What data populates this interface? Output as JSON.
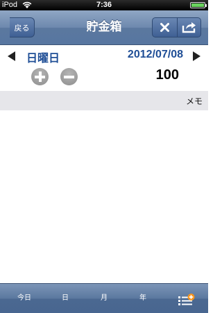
{
  "status_bar": {
    "carrier": "iPod",
    "time": "7:36"
  },
  "nav": {
    "back_label": "戻る",
    "title": "貯金箱",
    "close_icon": "close-icon",
    "share_icon": "share-icon"
  },
  "date_row": {
    "weekday": "日曜日",
    "date": "2012/07/08"
  },
  "amount": {
    "value": "100"
  },
  "memo": {
    "label": "メモ"
  },
  "tabs": [
    {
      "label": "今日"
    },
    {
      "label": "日"
    },
    {
      "label": "月"
    },
    {
      "label": "年"
    }
  ],
  "colors": {
    "accent_text": "#1f4e96",
    "nav_bg": "#6e89ae",
    "badge": "#f7941d"
  }
}
